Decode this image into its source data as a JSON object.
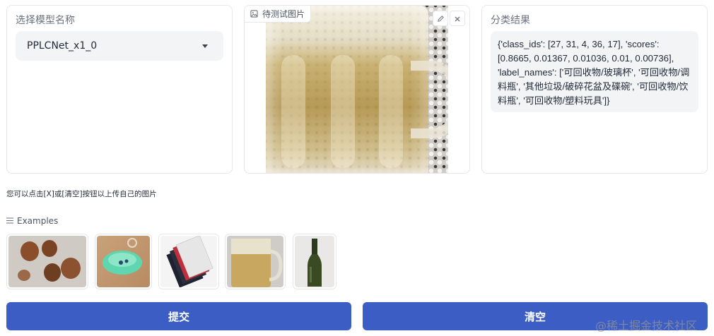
{
  "model_panel": {
    "label": "选择模型名称",
    "selected_model": "PPLCNet_x1_0"
  },
  "image_panel": {
    "label": "待测试图片"
  },
  "result_panel": {
    "label": "分类结果",
    "output": "{'class_ids': [27, 31, 4, 36, 17], 'scores': [0.8665, 0.01367, 0.01036, 0.01, 0.00736], 'label_names': ['可回收物/玻璃杯', '可回收物/调料瓶', '其他垃圾/破碎花盆及碟碗', '可回收物/饮料瓶', '可回收物/塑料玩具']}"
  },
  "hint": "您可以点击[X]或[清空]按钮以上传自己的图片",
  "examples": {
    "label": "Examples"
  },
  "buttons": {
    "submit": "提交",
    "clear": "清空"
  },
  "watermark": "@稀土掘金技术社区",
  "colors": {
    "primary": "#3b5dc4",
    "panel_border": "#e5e7eb",
    "field_bg": "#f3f4f6"
  },
  "icons": [
    "chevron-down-icon",
    "image-icon",
    "pencil-icon",
    "close-icon",
    "list-icon"
  ]
}
